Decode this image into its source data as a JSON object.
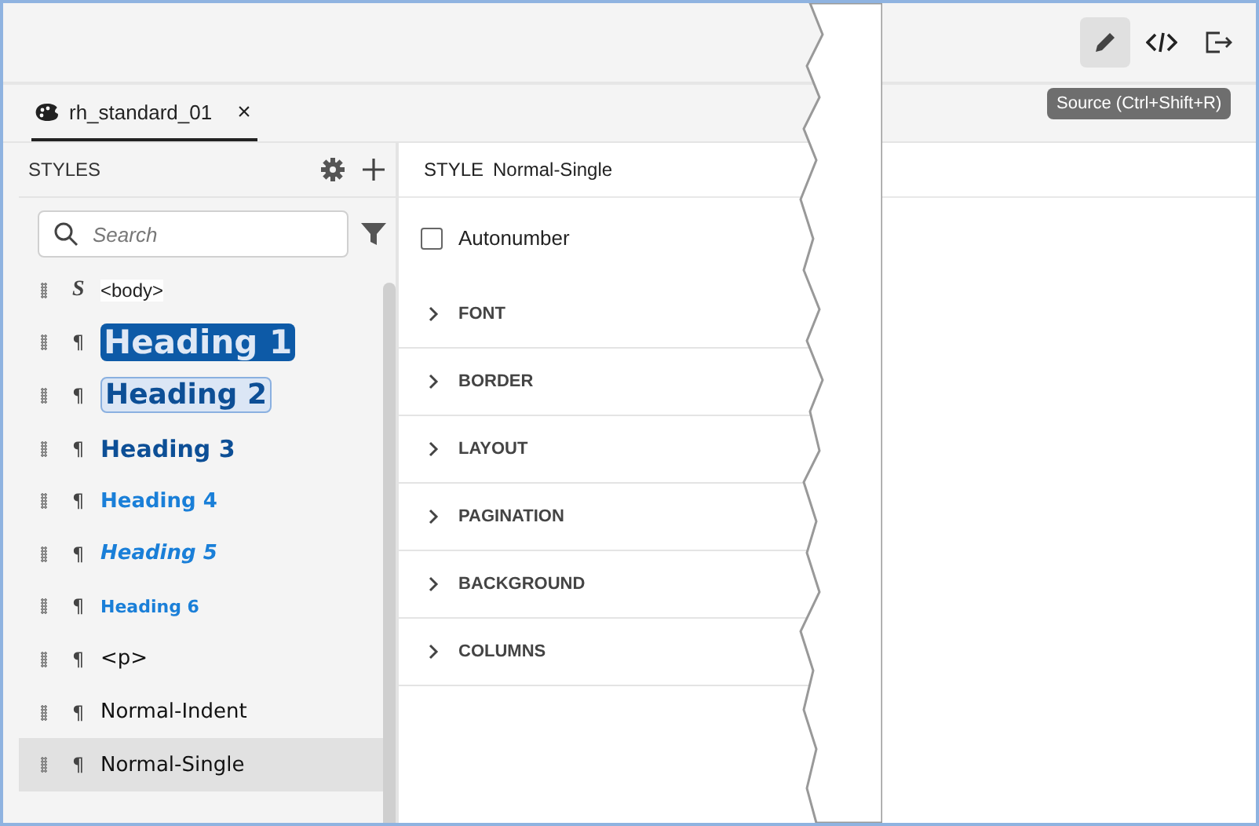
{
  "toolbar": {
    "buttons": [
      {
        "selected": true
      },
      {
        "selected": false
      },
      {
        "selected": false
      }
    ],
    "tooltip": "Source (Ctrl+Shift+R)"
  },
  "tabs": [
    {
      "label": "rh_standard_01",
      "close": "×",
      "selected": true
    }
  ],
  "styles_panel": {
    "title": "STYLES",
    "search": {
      "placeholder": "Search"
    },
    "items": [
      {
        "kind": "body",
        "marker": "S",
        "name": "<body>",
        "selected": false
      },
      {
        "kind": "h1",
        "marker": "¶",
        "name": "Heading 1",
        "selected": false
      },
      {
        "kind": "h2",
        "marker": "¶",
        "name": "Heading 2",
        "selected": false
      },
      {
        "kind": "h3",
        "marker": "¶",
        "name": "Heading 3",
        "selected": false
      },
      {
        "kind": "h4",
        "marker": "¶",
        "name": "Heading 4",
        "selected": false
      },
      {
        "kind": "h5",
        "marker": "¶",
        "name": "Heading 5",
        "selected": false
      },
      {
        "kind": "h6",
        "marker": "¶",
        "name": "Heading 6",
        "selected": false
      },
      {
        "kind": "p",
        "marker": "¶",
        "name": "<p>",
        "selected": false
      },
      {
        "kind": "p",
        "marker": "¶",
        "name": "Normal-Indent",
        "selected": false
      },
      {
        "kind": "p",
        "marker": "¶",
        "name": "Normal-Single",
        "selected": true
      }
    ]
  },
  "style_editor": {
    "label": "STYLE",
    "name": "Normal-Single",
    "autonumber": {
      "label": "Autonumber",
      "checked": false
    },
    "sections": [
      {
        "label": "FONT",
        "expanded": false
      },
      {
        "label": "BORDER",
        "expanded": false
      },
      {
        "label": "LAYOUT",
        "expanded": false
      },
      {
        "label": "PAGINATION",
        "expanded": false
      },
      {
        "label": "BACKGROUND",
        "expanded": false
      },
      {
        "label": "COLUMNS",
        "expanded": false
      }
    ]
  }
}
